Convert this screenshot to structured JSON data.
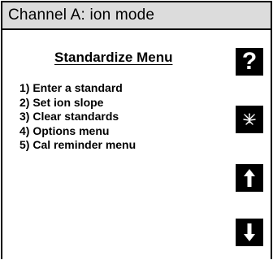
{
  "window": {
    "title": "Channel A: ion mode"
  },
  "menu": {
    "title": "Standardize Menu",
    "items": [
      {
        "label": "1) Enter a standard"
      },
      {
        "label": "2) Set ion slope"
      },
      {
        "label": "3) Clear standards"
      },
      {
        "label": "4) Options menu"
      },
      {
        "label": "5) Cal reminder menu"
      }
    ]
  },
  "softkeys": [
    {
      "icon": "help-icon",
      "glyph": "?"
    },
    {
      "icon": "sparkle-icon"
    },
    {
      "icon": "arrow-up-icon"
    },
    {
      "icon": "arrow-down-icon"
    }
  ],
  "colors": {
    "background": "#ffffff",
    "titlebar": "#dcdcdc",
    "softkey": "#000000",
    "text": "#000000"
  }
}
